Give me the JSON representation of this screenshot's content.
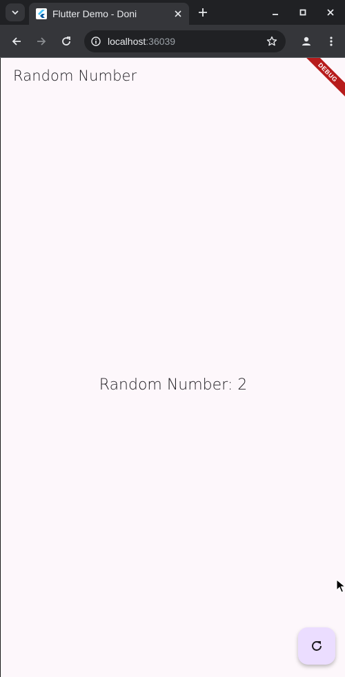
{
  "browser": {
    "tab_title": "Flutter Demo - Doni",
    "url_host": "localhost",
    "url_port": ":36039"
  },
  "app": {
    "appbar_title": "Random Number",
    "center_text": "Random Number: 2",
    "debug_banner": "DEBUG",
    "fab_icon": "refresh-icon"
  },
  "colors": {
    "background": "#fdf7fb",
    "fab": "#ebddff",
    "debug_banner": "#b71c1c"
  }
}
